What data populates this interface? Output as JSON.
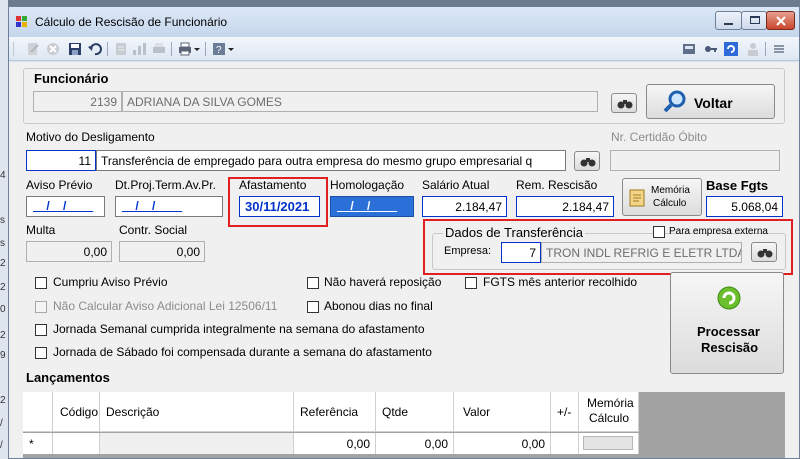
{
  "window": {
    "title": "Cálculo de Rescisão de Funcionário"
  },
  "desktop": {
    "strip_letters": [
      "4",
      "s",
      "s",
      "2",
      "2",
      "0",
      "2",
      "9",
      "2",
      "/",
      "/"
    ]
  },
  "funcionario": {
    "group_label": "Funcionário",
    "code": "2139",
    "name": "ADRIANA DA SILVA GOMES",
    "voltar_label": "Voltar"
  },
  "motivo": {
    "label": "Motivo do Desligamento",
    "code": "11",
    "description": "Transferência de empregado para outra empresa do mesmo grupo empresarial q",
    "certidao_label": "Nr. Certidão Óbito",
    "certidao_value": ""
  },
  "dates": {
    "aviso_label": "Aviso Prévio",
    "aviso_value": "__/__/____",
    "dtproj_label": "Dt.Proj.Term.Av.Pr.",
    "dtproj_value": "__/__/____",
    "afastamento_label": "Afastamento",
    "afastamento_value": "30/11/2021",
    "homologacao_label": "Homologação",
    "homologacao_value": "__/__/____"
  },
  "salario": {
    "label": "Salário Atual",
    "value": "2.184,47"
  },
  "remrescisao": {
    "label": "Rem. Rescisão",
    "value": "2.184,47"
  },
  "memoria_btn": {
    "line1": "Memória",
    "line2": "Cálculo"
  },
  "basefgts": {
    "label": "Base Fgts",
    "value": "5.068,04"
  },
  "multa": {
    "label": "Multa",
    "value": "0,00"
  },
  "contrsocial": {
    "label": "Contr. Social",
    "value": "0,00"
  },
  "transferencia": {
    "label": "Dados de Transferência",
    "externa_label": "Para empresa externa",
    "empresa_label": "Empresa:",
    "empresa_code": "7",
    "empresa_name": "TRON INDL REFRIG E ELETR LTDA"
  },
  "checks": {
    "cumpriu": "Cumpriu Aviso Prévio",
    "naocalcular": "Não Calcular Aviso Adicional Lei 12506/11",
    "jornada_semanal": "Jornada Semanal cumprida integralmente na semana do afastamento",
    "jornada_sabado": "Jornada de Sábado foi compensada durante a semana do afastamento",
    "naohavera": "Não haverá reposição",
    "abonou": "Abonou dias no final",
    "fgts": "FGTS mês anterior recolhido"
  },
  "processar": {
    "line1": "Processar",
    "line2": "Rescisão"
  },
  "lancamentos": {
    "label": "Lançamentos",
    "columns": [
      "Código",
      "Descrição",
      "Referência",
      "Qtde",
      "Valor",
      "+/-",
      "Memória",
      "Cálculo"
    ],
    "row_marker": "*",
    "row": {
      "referencia": "0,00",
      "qtde": "0,00",
      "valor": "0,00"
    }
  }
}
